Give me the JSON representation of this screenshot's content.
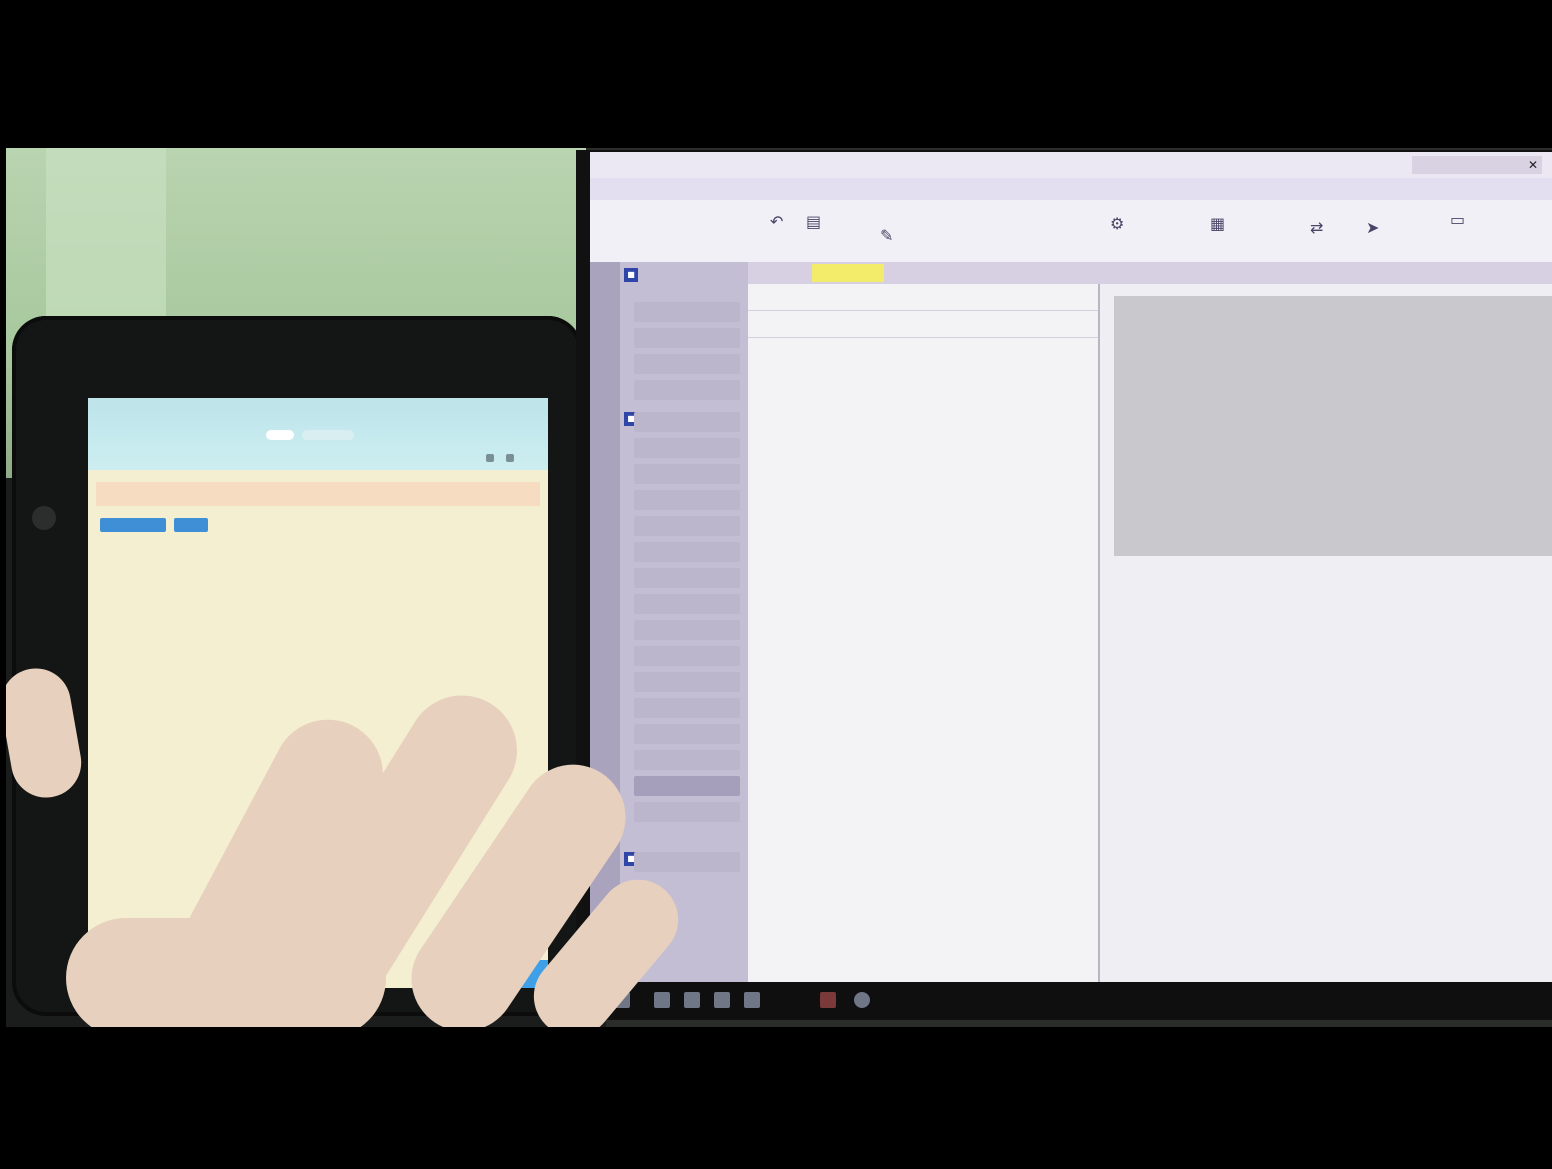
{
  "scene": {
    "description_tags": [
      "tablet",
      "laptop-monitor",
      "hand"
    ]
  },
  "tablet": {
    "title": "",
    "pill_a": "",
    "pill_b": "",
    "search_placeholder": "",
    "button_a": "",
    "button_b": "",
    "lines": [
      "",
      "",
      "",
      "",
      "",
      "",
      "",
      "",
      "",
      "",
      "",
      "",
      "",
      "",
      "",
      "",
      "",
      "",
      "",
      "",
      ""
    ]
  },
  "desktop_app": {
    "ribbon_tabs": [
      "",
      "",
      "",
      "",
      "",
      "",
      "",
      "",
      ""
    ],
    "nav_items": [
      "",
      "",
      "",
      "",
      "",
      "",
      "",
      "",
      "",
      "",
      "",
      "",
      "",
      "",
      "",
      "",
      "",
      "",
      "",
      "",
      ""
    ],
    "content_tabs": [
      "",
      "",
      "",
      "",
      "",
      "",
      "",
      "",
      "",
      ""
    ],
    "rows": [
      "",
      ""
    ]
  }
}
